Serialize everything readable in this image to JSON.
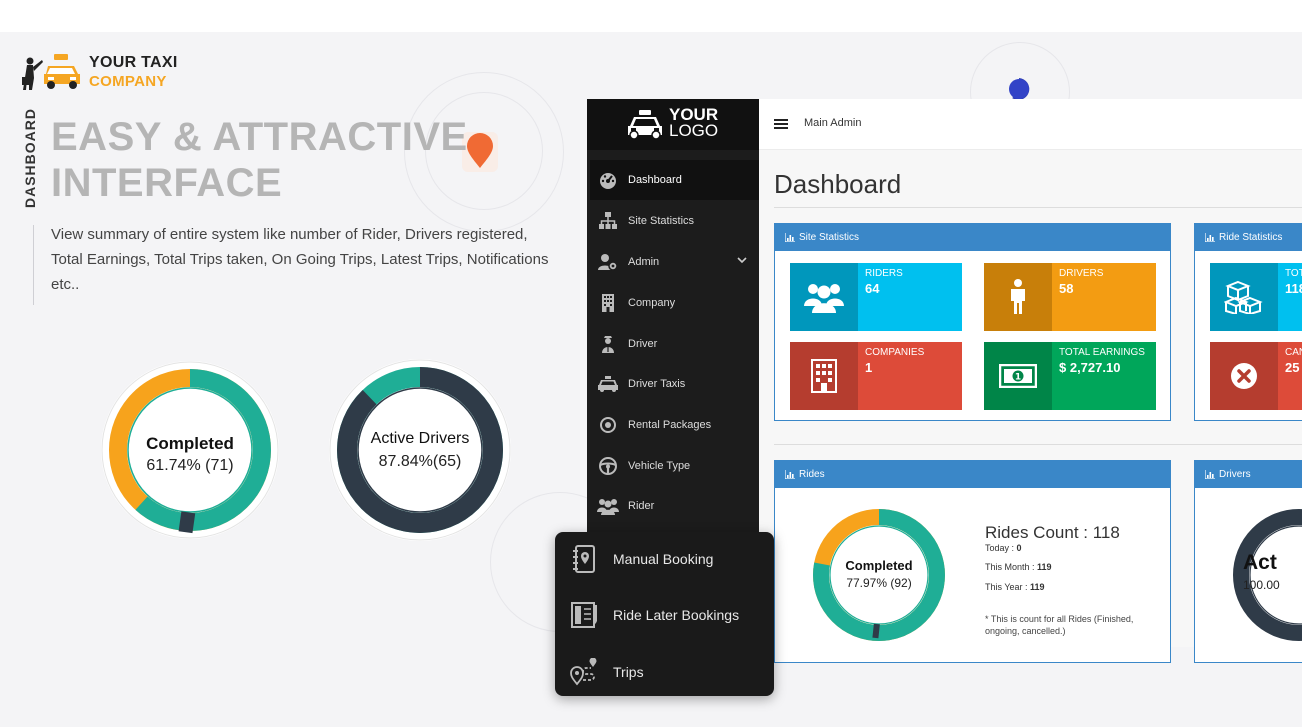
{
  "brand": {
    "line1": "YOUR TAXI",
    "line2": "COMPANY",
    "sign": "TAXI"
  },
  "side_label": "DASHBOARD",
  "headline": {
    "line1": "EASY & ATTRACTIVE",
    "line2": "INTERFACE"
  },
  "description": "View summary of entire system like number of Rider, Drivers registered, Total Earnings, Total Trips taken, On Going Trips, Latest Trips, Notifications etc..",
  "donut_completed": {
    "label": "Completed",
    "value": "61.74% (71)",
    "fraction": 0.6174,
    "colors": {
      "primary": "#1fae96",
      "secondary": "#f7a31c"
    }
  },
  "donut_active": {
    "label": "Active Drivers",
    "value": "87.84%(65)",
    "fraction": 0.8784,
    "colors": {
      "primary": "#2f3b48",
      "secondary": "#1fae96"
    }
  },
  "app": {
    "logo": {
      "line1": "YOUR",
      "line2": "LOGO"
    },
    "sidebar": [
      {
        "label": "Dashboard",
        "icon": "dashboard-gauge-icon",
        "active": true
      },
      {
        "label": "Site Statistics",
        "icon": "sitemap-icon"
      },
      {
        "label": "Admin",
        "icon": "admin-users-icon",
        "has_submenu": true
      },
      {
        "label": "Company",
        "icon": "building-icon"
      },
      {
        "label": "Driver",
        "icon": "driver-icon"
      },
      {
        "label": "Driver Taxis",
        "icon": "taxi-icon"
      },
      {
        "label": "Rental Packages",
        "icon": "target-icon"
      },
      {
        "label": "Vehicle Type",
        "icon": "steering-wheel-icon"
      },
      {
        "label": "Rider",
        "icon": "rider-group-icon"
      }
    ],
    "topbar": {
      "user": "Main Admin"
    },
    "title": "Dashboard",
    "site_statistics": {
      "title": "Site Statistics",
      "tiles": [
        {
          "name": "RIDERS",
          "value": "64",
          "color": "#00c0ef",
          "icon_bg": "#0097bc"
        },
        {
          "name": "DRIVERS",
          "value": "58",
          "color": "#f39c12",
          "icon_bg": "#c87f0a"
        },
        {
          "name": "COMPANIES",
          "value": "1",
          "color": "#dd4b39",
          "icon_bg": "#b53d2f"
        },
        {
          "name": "TOTAL EARNINGS",
          "value": "$ 2,727.10",
          "color": "#00a65a",
          "icon_bg": "#008548"
        }
      ]
    },
    "ride_statistics": {
      "title": "Ride Statistics",
      "tiles": [
        {
          "name": "TOT",
          "value": "118",
          "color": "#00c0ef",
          "icon_bg": "#0097bc"
        },
        {
          "name": "CAN",
          "value": "25",
          "color": "#dd4b39",
          "icon_bg": "#b53d2f"
        }
      ]
    },
    "rides": {
      "title": "Rides",
      "donut_label": "Completed",
      "donut_value": "77.97% (92)",
      "fraction": 0.7797,
      "count_label": "Rides Count : 118",
      "today_label": "Today : ",
      "today_value": "0",
      "month_label": "This Month : ",
      "month_value": "119",
      "year_label": "This Year : ",
      "year_value": "119",
      "note": "* This is count for all Rides (Finished, ongoing, cancelled.)"
    },
    "drivers": {
      "title": "Drivers",
      "donut_label": "Act",
      "donut_value": "100.00"
    }
  },
  "popup_menu": [
    {
      "label": "Manual Booking",
      "icon": "notebook-pin-icon"
    },
    {
      "label": "Ride Later Bookings",
      "icon": "calendar-book-icon"
    },
    {
      "label": "Trips",
      "icon": "route-pin-icon"
    }
  ]
}
